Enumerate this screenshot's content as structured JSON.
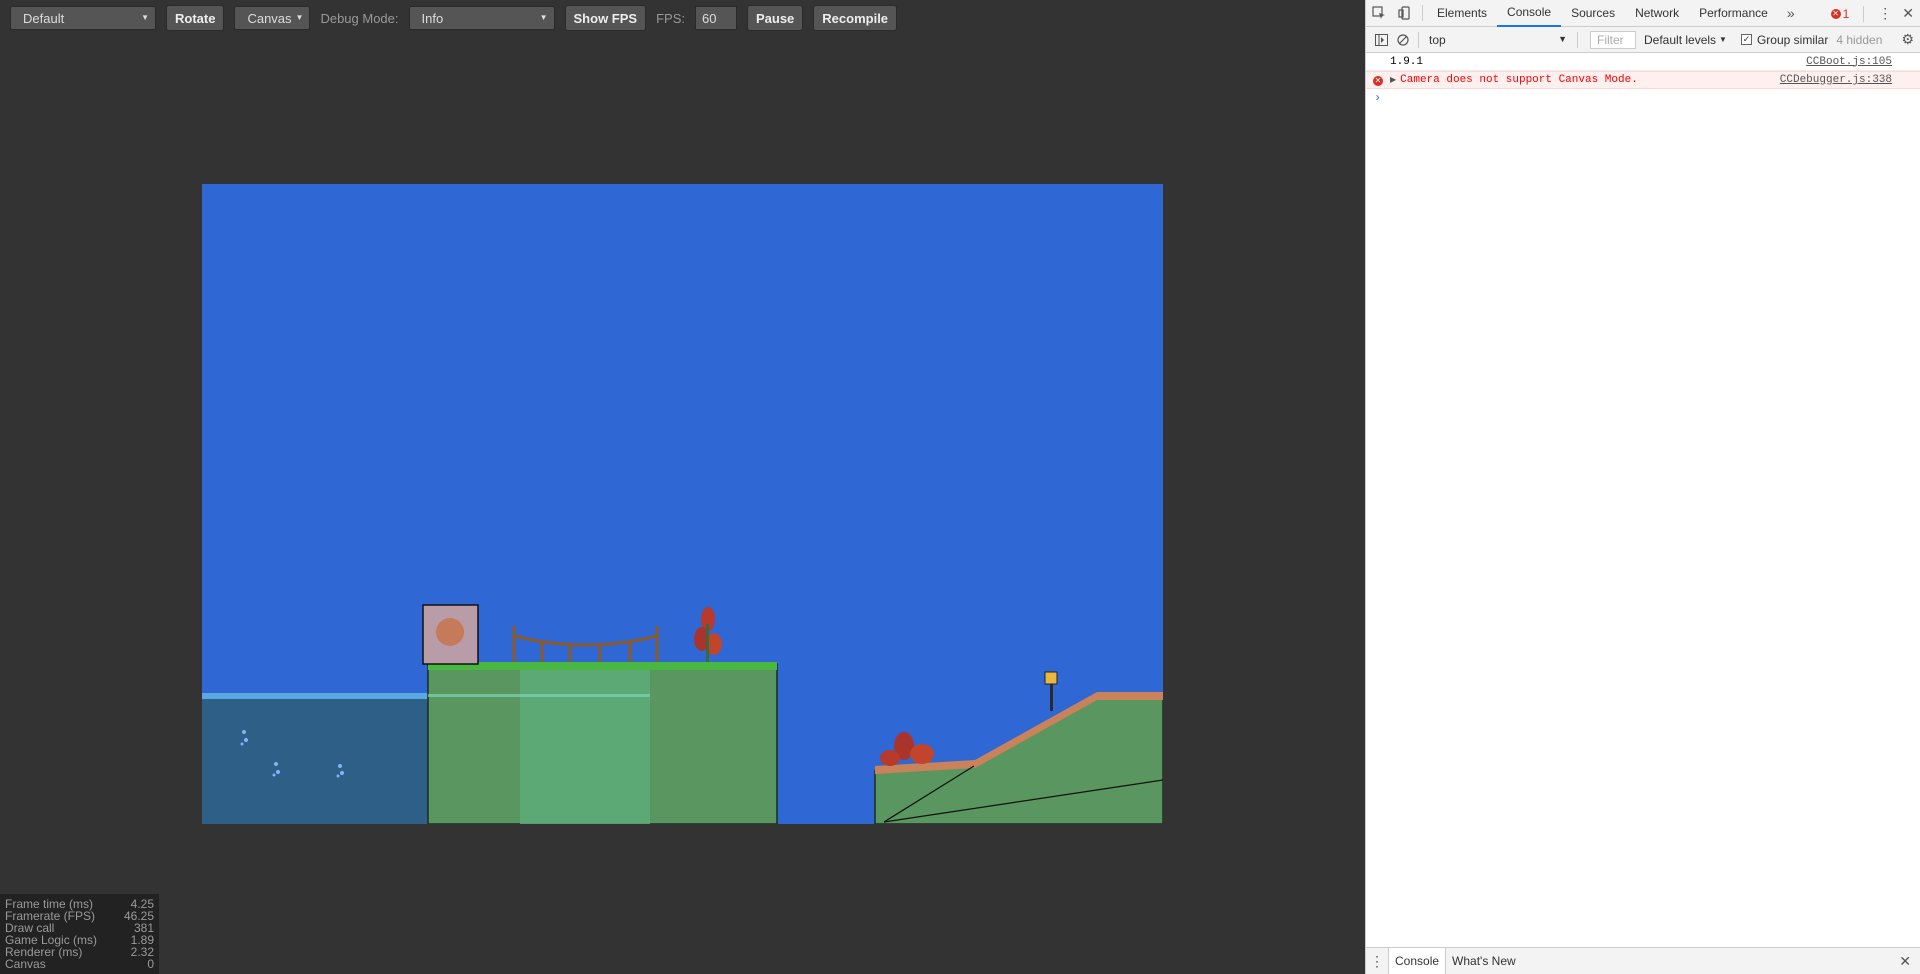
{
  "toolbar": {
    "resolution": "Default",
    "rotate_label": "Rotate",
    "renderer": "Canvas",
    "debug_mode_label": "Debug Mode:",
    "debug_mode_value": "Info",
    "show_fps_label": "Show FPS",
    "fps_label": "FPS:",
    "fps_value": "60",
    "pause_label": "Pause",
    "recompile_label": "Recompile"
  },
  "stats": [
    {
      "label": "Frame time (ms)",
      "value": "4.25"
    },
    {
      "label": "Framerate (FPS)",
      "value": "46.25"
    },
    {
      "label": "Draw call",
      "value": "381"
    },
    {
      "label": "Game Logic (ms)",
      "value": "1.89"
    },
    {
      "label": "Renderer (ms)",
      "value": "2.32"
    },
    {
      "label": "Canvas",
      "value": "0"
    }
  ],
  "devtools": {
    "tabs": [
      "Elements",
      "Console",
      "Sources",
      "Network",
      "Performance"
    ],
    "active_tab": "Console",
    "more_tabs_icon": "double-chevron-right",
    "error_count": "1",
    "context": "top",
    "filter_placeholder": "Filter",
    "levels_label": "Default levels",
    "group_similar_label": "Group similar",
    "hidden_label": "4 hidden",
    "console_lines": [
      {
        "text": "1.9.1",
        "source": "CCBoot.js:105",
        "level": "log"
      },
      {
        "text": "Camera does not support Canvas Mode.",
        "source": "CCDebugger.js:338",
        "level": "error"
      }
    ],
    "prompt_symbol": "›",
    "drawer_tabs": [
      "Console",
      "What's New"
    ]
  },
  "colors": {
    "editor_bg": "#333333",
    "sky": "#2f68d4",
    "water": "#2e5f87",
    "grass_dark": "#5a9660",
    "grass_light": "#5dad7a",
    "error_red": "#d93025"
  }
}
